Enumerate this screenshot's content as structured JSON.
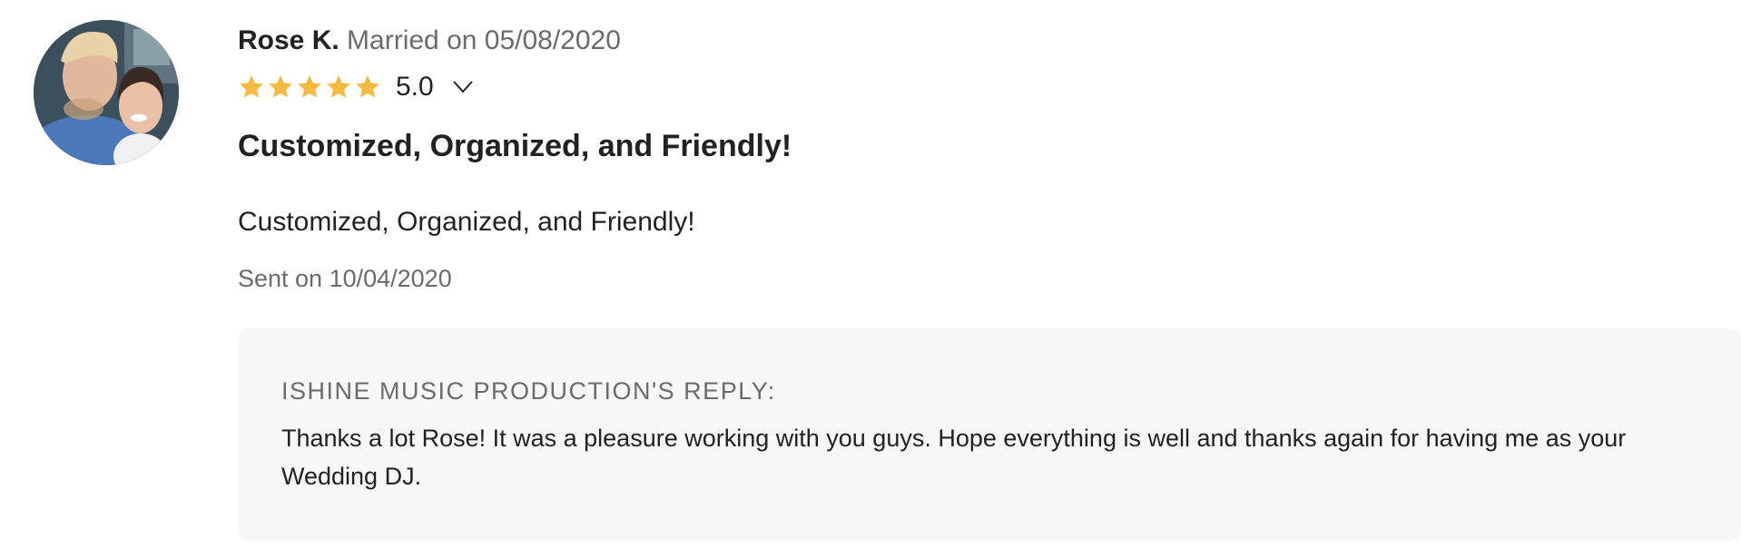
{
  "review": {
    "reviewer_name": "Rose K.",
    "married_text": "Married on 05/08/2020",
    "rating": {
      "stars": 5,
      "max": 5,
      "value_text": "5.0",
      "star_color": "#f5bb41",
      "icon": "star-icon"
    },
    "expand_icon": "chevron-down-icon",
    "title": "Customized, Organized, and Friendly!",
    "body": "Customized, Organized, and Friendly!",
    "sent_text": "Sent on 10/04/2020"
  },
  "reply": {
    "heading": "ISHINE MUSIC PRODUCTION'S REPLY:",
    "text": "Thanks a lot Rose! It was a pleasure working with you guys. Hope everything is well and thanks again for having me as your Wedding DJ."
  },
  "colors": {
    "text_primary": "#222222",
    "text_secondary": "#6b6b6b",
    "reply_background": "#f7f7f7"
  }
}
